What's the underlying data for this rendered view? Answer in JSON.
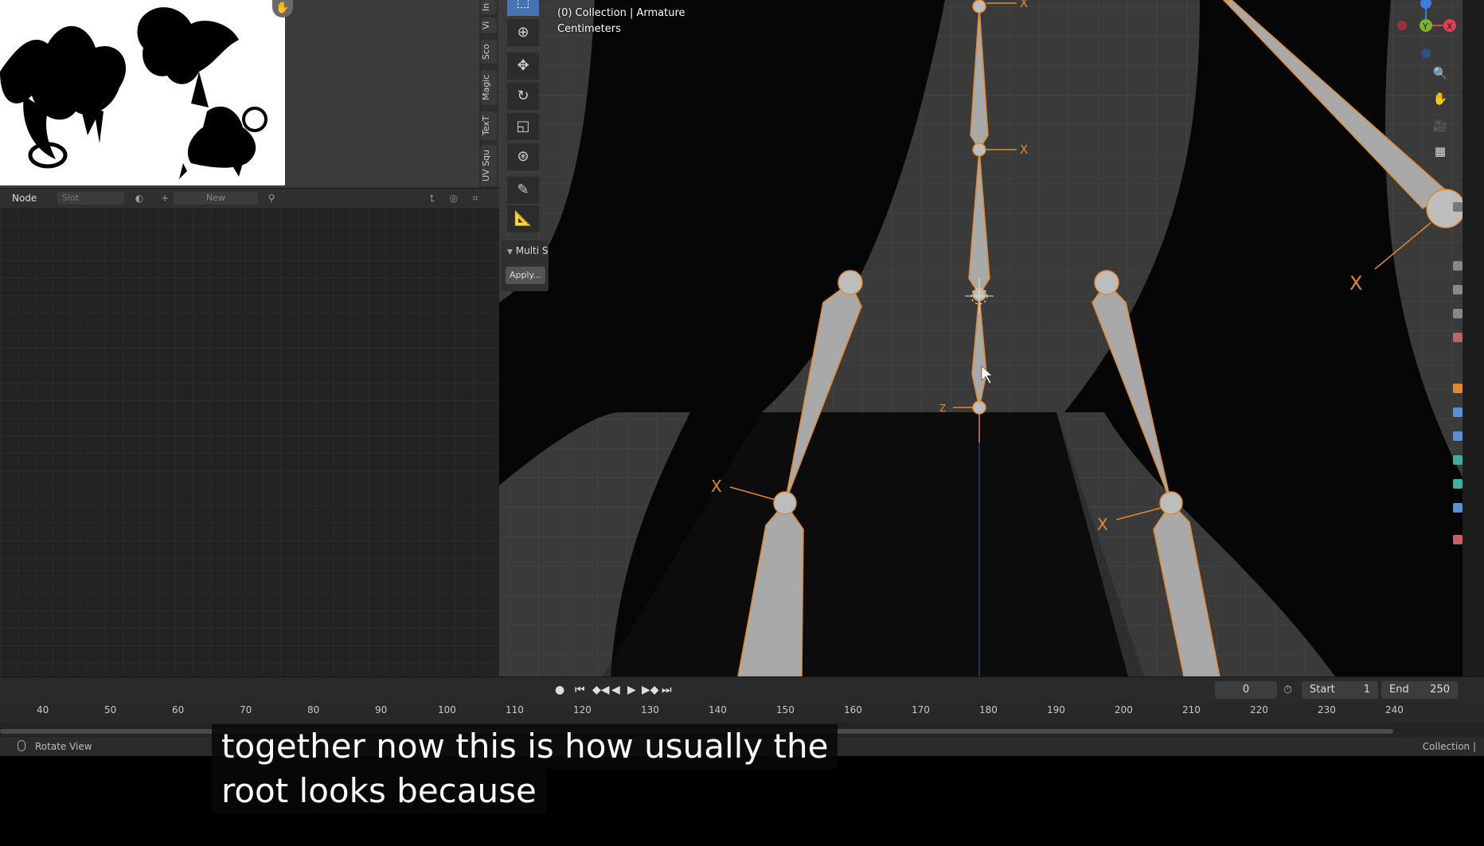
{
  "reference_panel": {
    "tabs": [
      "In",
      "Vi",
      "Sco",
      "Magic",
      "TexT",
      "UV Squ"
    ]
  },
  "node_header": {
    "mode": "Node",
    "slot": "Slot",
    "new_label": "New"
  },
  "viewport": {
    "info_line1": "(0) Collection | Armature",
    "info_line2": "Centimeters",
    "multi_panel_title": "Multi S",
    "apply_label": "Apply...",
    "axis_labels": {
      "x": "X",
      "y": "Y",
      "z": "Z"
    },
    "tools": [
      "select-box-icon",
      "cursor-icon",
      "move-icon",
      "rotate-icon",
      "scale-icon",
      "transform-icon",
      "annotate-icon",
      "measure-icon"
    ]
  },
  "timeline": {
    "current_frame": "0",
    "start_label": "Start",
    "start_value": "1",
    "end_label": "End",
    "end_value": "250",
    "ticks": [
      "40",
      "50",
      "60",
      "70",
      "80",
      "90",
      "100",
      "110",
      "120",
      "130",
      "140",
      "150",
      "160",
      "170",
      "180",
      "190",
      "200",
      "210",
      "220",
      "230",
      "240"
    ]
  },
  "status_bar": {
    "left": "Rotate View",
    "right": "Collection |"
  },
  "subtitle": {
    "line1": "together now this is how usually the",
    "line2": "root looks because"
  },
  "colors": {
    "accent_blue": "#4772b3",
    "bone_outline": "#e08a30",
    "axis_x": "#e04050",
    "axis_y": "#7bb32e",
    "axis_z": "#3b7ee0"
  }
}
